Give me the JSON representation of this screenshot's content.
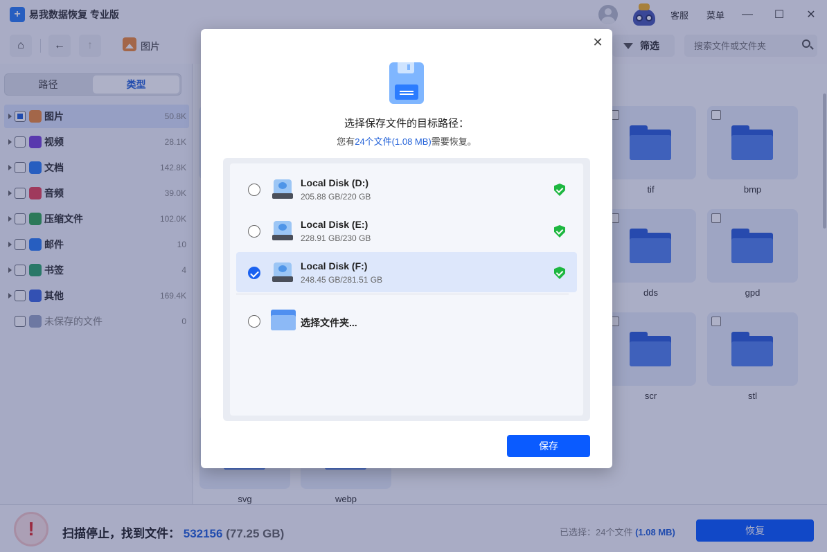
{
  "app": {
    "title": "易我数据恢复 专业版",
    "customer_service": "客服",
    "menu": "菜单",
    "minimize": "—",
    "maximize": "☐",
    "close": "✕"
  },
  "toolbar": {
    "home": "⌂",
    "back": "←",
    "up": "↑",
    "breadcrumb": "图片",
    "filter_label": "筛选",
    "search_placeholder": "搜索文件或文件夹"
  },
  "sidebar": {
    "tabs": [
      {
        "label": "路径",
        "active": false
      },
      {
        "label": "类型",
        "active": true
      }
    ],
    "categories": [
      {
        "label": "图片",
        "count": "50.8K",
        "color": "#ee8a3a",
        "icon": "image-icon"
      },
      {
        "label": "视频",
        "count": "28.1K",
        "color": "#7b44d8",
        "icon": "video-icon"
      },
      {
        "label": "文档",
        "count": "142.8K",
        "color": "#2d7ef5",
        "icon": "document-icon"
      },
      {
        "label": "音频",
        "count": "39.0K",
        "color": "#e8455a",
        "icon": "audio-icon"
      },
      {
        "label": "压缩文件",
        "count": "102.0K",
        "color": "#34a853",
        "icon": "archive-icon"
      },
      {
        "label": "邮件",
        "count": "10",
        "color": "#2d7ef5",
        "icon": "mail-icon"
      },
      {
        "label": "书签",
        "count": "4",
        "color": "#2fa66b",
        "icon": "bookmark-icon"
      },
      {
        "label": "其他",
        "count": "169.4K",
        "color": "#3f6ae0",
        "icon": "other-icon"
      },
      {
        "label": "未保存的文件",
        "count": "0",
        "color": "#9aa6c6",
        "icon": "unsaved-file-icon"
      }
    ]
  },
  "grid": {
    "files": [
      "tif",
      "bmp",
      "dds",
      "gpd",
      "scr",
      "stl",
      "svg",
      "webp"
    ]
  },
  "status": {
    "scan_label": "扫描停止，找到文件：",
    "found_count": "532156",
    "found_size": "(77.25 GB)",
    "selected_label": "已选择：24个文件",
    "selected_size": "(1.08 MB)",
    "recover_button": "恢复"
  },
  "modal": {
    "title": "选择保存文件的目标路径：",
    "sub_prefix": "您有",
    "sub_highlight": "24个文件(1.08 MB)",
    "sub_suffix": "需要恢复。",
    "close": "✕",
    "destinations": [
      {
        "name": "Local Disk (D:)",
        "size": "205.88 GB/220 GB",
        "selected": false
      },
      {
        "name": "Local Disk (E:)",
        "size": "228.91 GB/230 GB",
        "selected": false
      },
      {
        "name": "Local Disk (F:)",
        "size": "248.45 GB/281.51 GB",
        "selected": true
      }
    ],
    "choose_folder": "选择文件夹...",
    "save_button": "保存"
  }
}
